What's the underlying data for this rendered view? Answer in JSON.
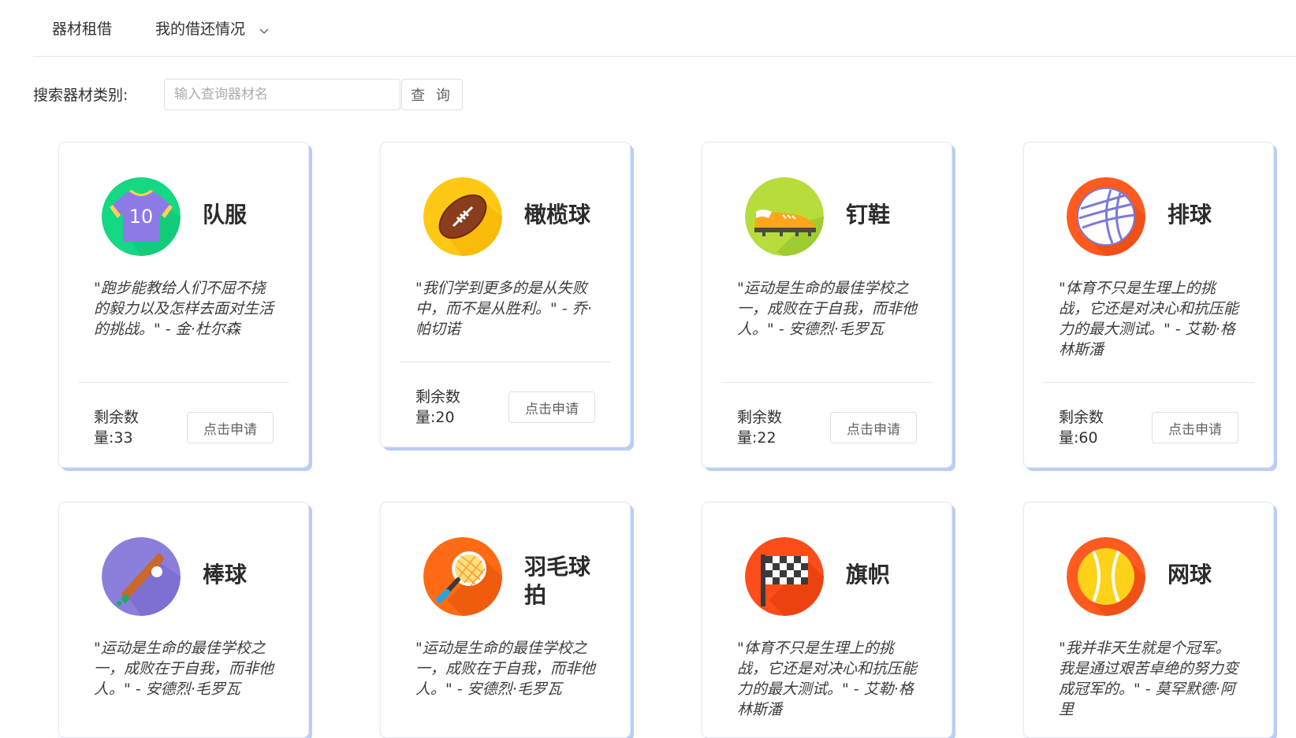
{
  "nav": {
    "items": [
      {
        "label": "器材租借"
      },
      {
        "label": "我的借还情况"
      }
    ]
  },
  "search": {
    "label": "搜索器材类别:",
    "placeholder": "输入查询器材名",
    "button_label": "查 询"
  },
  "cards": [
    {
      "name": "队服",
      "icon": "jersey-icon",
      "quote": "\"跑步能教给人们不屈不挠的毅力以及怎样去面对生活的挑战。\" - 金·杜尔森",
      "remain_label": "剩余数量:",
      "remain_value": "33",
      "button_label": "点击申请"
    },
    {
      "name": "橄榄球",
      "icon": "football-icon",
      "quote": "\"我们学到更多的是从失败中，而不是从胜利。\" - 乔·帕切诺",
      "remain_label": "剩余数量:",
      "remain_value": "20",
      "button_label": "点击申请"
    },
    {
      "name": "钉鞋",
      "icon": "spike-shoe-icon",
      "quote": "\"运动是生命的最佳学校之一，成败在于自我，而非他人。\" - 安德烈·毛罗瓦",
      "remain_label": "剩余数量:",
      "remain_value": "22",
      "button_label": "点击申请"
    },
    {
      "name": "排球",
      "icon": "volleyball-icon",
      "quote": "\"体育不只是生理上的挑战，它还是对决心和抗压能力的最大测试。\" - 艾勒·格林斯潘",
      "remain_label": "剩余数量:",
      "remain_value": "60",
      "button_label": "点击申请"
    },
    {
      "name": "棒球",
      "icon": "baseball-bat-icon",
      "quote": "\"运动是生命的最佳学校之一，成败在于自我，而非他人。\" - 安德烈·毛罗瓦"
    },
    {
      "name": "羽毛球拍",
      "icon": "badminton-racket-icon",
      "quote": "\"运动是生命的最佳学校之一，成败在于自我，而非他人。\" - 安德烈·毛罗瓦"
    },
    {
      "name": "旗帜",
      "icon": "checkered-flag-icon",
      "quote": "\"体育不只是生理上的挑战，它还是对决心和抗压能力的最大测试。\" - 艾勒·格林斯潘"
    },
    {
      "name": "网球",
      "icon": "tennis-ball-icon",
      "quote": "\"我并非天生就是个冠军。我是通过艰苦卓绝的努力变成冠军的。\" - 莫罕默德·阿里"
    }
  ],
  "colors": {
    "card_shadow": "#b9cdf5",
    "border": "#dcdfe6"
  }
}
